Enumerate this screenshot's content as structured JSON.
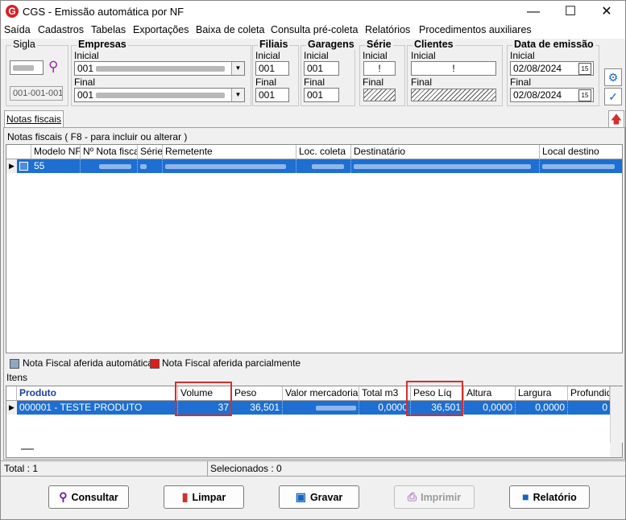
{
  "window": {
    "title": "CGS - Emissão automática por NF",
    "logo": "G",
    "minimize": "—",
    "maximize": "☐",
    "close": "✕"
  },
  "menu": [
    "Saída",
    "Cadastros",
    "Tabelas",
    "Exportações",
    "Baixa de coleta",
    "Consulta pré-coleta",
    "Relatórios",
    "Procedimentos auxiliares"
  ],
  "filters": {
    "sigla": {
      "label": "Sigla",
      "code_placeholder": "",
      "value": "001-001-001"
    },
    "empresas": {
      "label": "Empresas",
      "inicial_label": "Inicial",
      "final_label": "Final",
      "inicial_value": "001",
      "final_value": "001"
    },
    "filiais": {
      "label": "Filiais",
      "inicial_label": "Inicial",
      "final_label": "Final",
      "inicial_value": "001",
      "final_value": "001"
    },
    "garagens": {
      "label": "Garagens",
      "inicial_label": "Inicial",
      "final_label": "Final",
      "inicial_value": "001",
      "final_value": "001"
    },
    "serie": {
      "label": "Série",
      "inicial_label": "Inicial",
      "final_label": "Final",
      "inicial_value": "!"
    },
    "clientes": {
      "label": "Clientes",
      "inicial_label": "Inicial",
      "final_label": "Final",
      "inicial_value": "!"
    },
    "data_emissao": {
      "label": "Data de emissão",
      "inicial_label": "Inicial",
      "final_label": "Final",
      "inicial_value": "02/08/2024",
      "final_value": "02/08/2024",
      "calendar": "15"
    }
  },
  "tab": "Notas fiscais",
  "notas": {
    "caption": "Notas fiscais ( F8 - para incluir ou alterar )",
    "columns": [
      "Modelo NF",
      "Nº Nota fiscal",
      "Série",
      "Remetente",
      "Loc. coleta",
      "Destinatário",
      "Local destino"
    ],
    "row_first_cell": "55"
  },
  "legend": {
    "auto": "Nota Fiscal aferida automática",
    "parcial": "Nota Fiscal aferida parcialmente",
    "auto_color": "#8da9c4",
    "parcial_color": "#e01b1b"
  },
  "itens": {
    "caption": "Itens",
    "columns": [
      "Produto",
      "Volume",
      "Peso",
      "Valor mercadoria",
      "Total m3",
      "Peso Líq",
      "Altura",
      "Largura",
      "Profundid"
    ],
    "row": {
      "produto": "000001 - TESTE PRODUTO",
      "volume": "37",
      "peso": "36,501",
      "total_m3": "0,0000",
      "peso_liq": "36,501",
      "altura": "0,0000",
      "largura": "0,0000",
      "profundidade": "0"
    }
  },
  "status": {
    "total": "Total : 1",
    "selecionados": "Selecionados : 0"
  },
  "buttons": {
    "consultar": "Consultar",
    "limpar": "Limpar",
    "gravar": "Gravar",
    "imprimir": "Imprimir",
    "relatorio": "Relatório"
  },
  "colors": {
    "selection": "#1e6fd1",
    "highlight": "#d32f2f",
    "accent": "#1565c0"
  }
}
